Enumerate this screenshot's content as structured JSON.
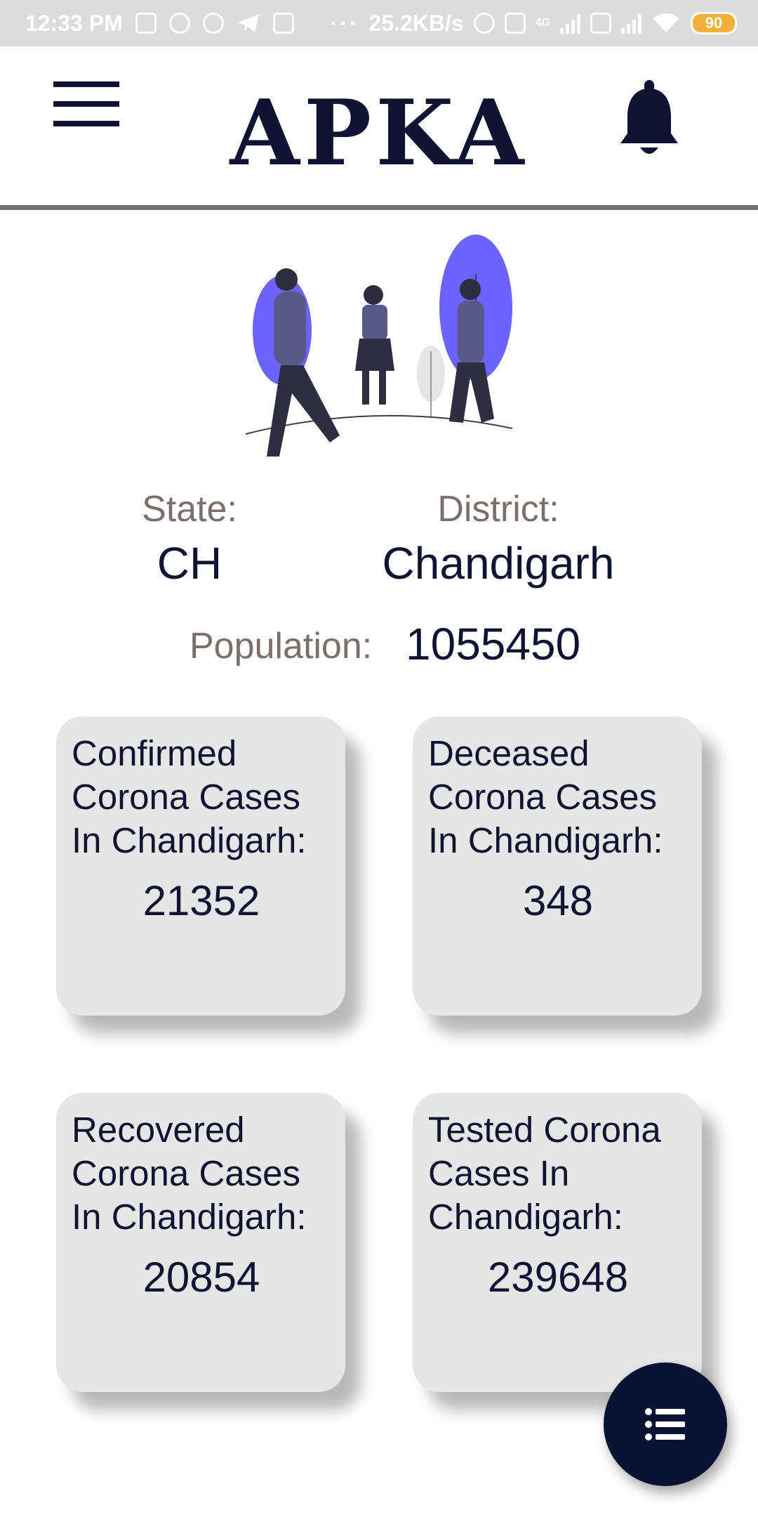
{
  "status_bar": {
    "time": "12:33 PM",
    "net_speed": "25.2KB/s",
    "network_label": "4G",
    "battery": "90",
    "dots": "···"
  },
  "header": {
    "brand": "APKA",
    "menu_icon": "hamburger-menu-icon",
    "notification_icon": "bell-icon"
  },
  "location": {
    "state_label": "State:",
    "state_value": "CH",
    "district_label": "District:",
    "district_value": "Chandigarh",
    "population_label": "Population:",
    "population_value": "1055450"
  },
  "cards": [
    {
      "title_line1": "Confirmed",
      "title_line2": "Corona Cases",
      "title_line3": "In Chandigarh:",
      "value": "21352"
    },
    {
      "title_line1": "Deceased",
      "title_line2": "Corona Cases",
      "title_line3": "In Chandigarh:",
      "value": "348"
    },
    {
      "title_line1": "Recovered",
      "title_line2": "Corona Cases",
      "title_line3": "In Chandigarh:",
      "value": "20854"
    },
    {
      "title_line1": "Tested Corona",
      "title_line2": "Cases In",
      "title_line3": "Chandigarh:",
      "value": "239648"
    }
  ],
  "fab": {
    "icon": "list-icon"
  },
  "colors": {
    "primary": "#0f1433",
    "accent": "#6c63ff",
    "label": "#7a6f6d",
    "card_bg": "#e6e6e6",
    "fab_bg": "#0a1233"
  }
}
